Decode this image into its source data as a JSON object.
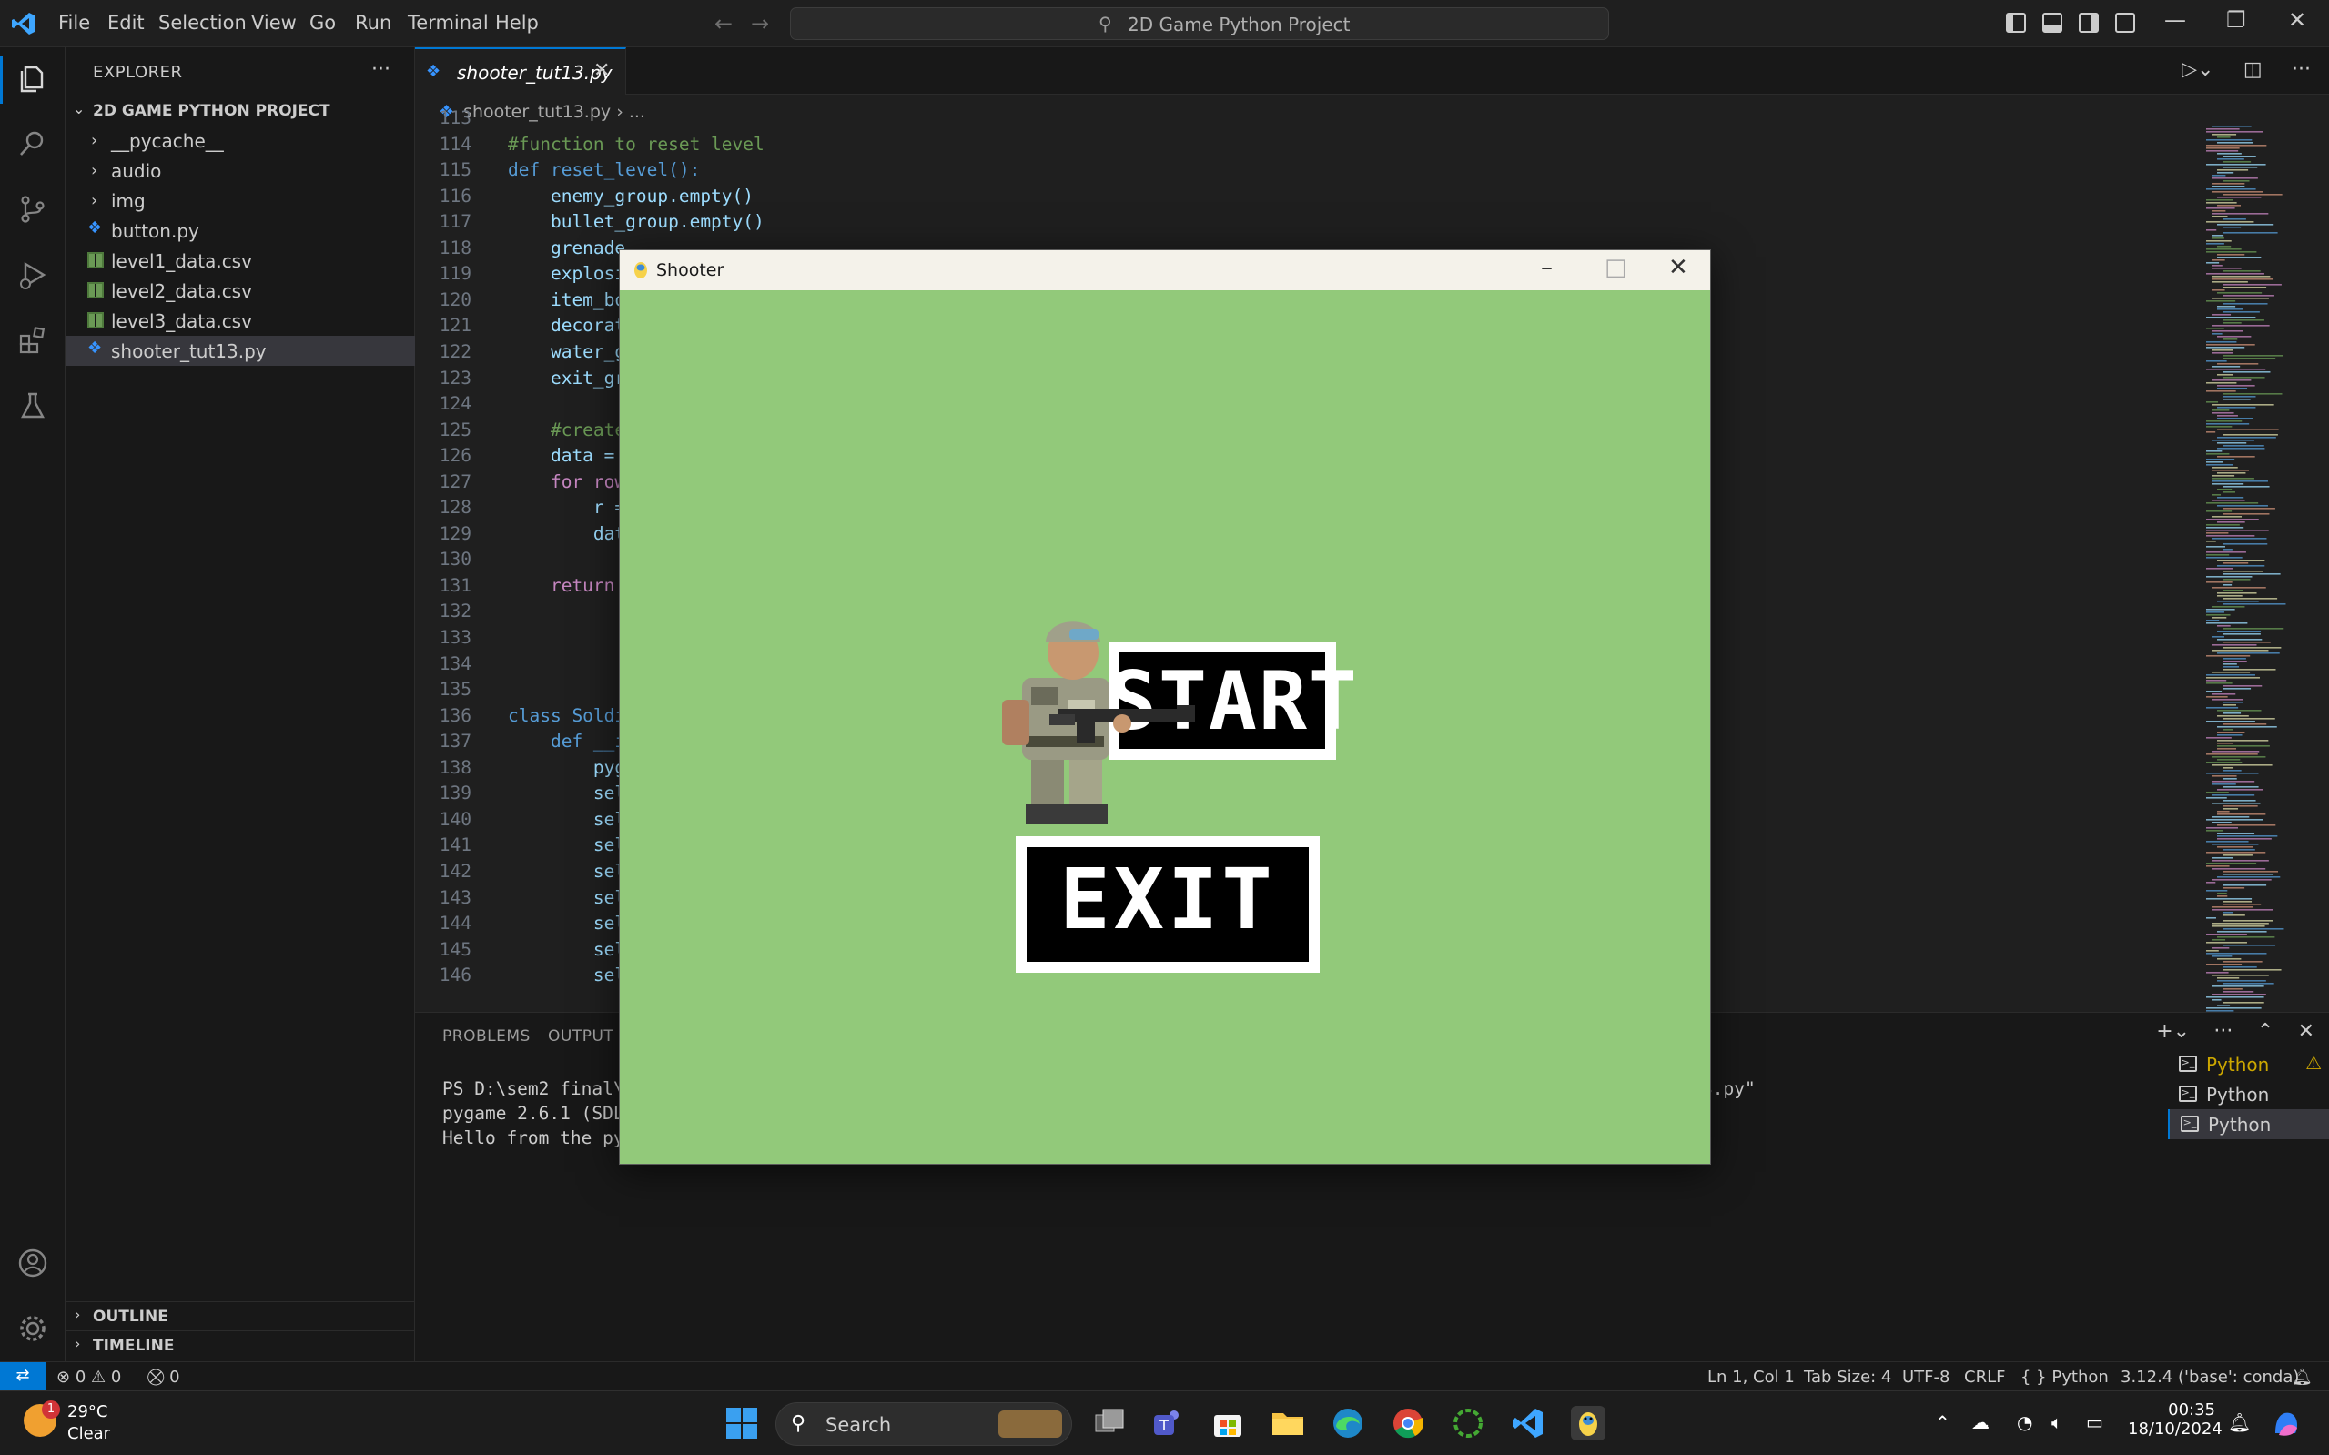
{
  "titlebar": {
    "menu": [
      "File",
      "Edit",
      "Selection",
      "View",
      "Go",
      "Run",
      "Terminal",
      "Help"
    ],
    "search_text": "2D Game Python Project"
  },
  "sidebar": {
    "title": "EXPLORER",
    "project": "2D GAME PYTHON PROJECT",
    "items": [
      {
        "label": "__pycache__",
        "type": "folder"
      },
      {
        "label": "audio",
        "type": "folder"
      },
      {
        "label": "img",
        "type": "folder"
      },
      {
        "label": "button.py",
        "type": "py"
      },
      {
        "label": "level1_data.csv",
        "type": "csv"
      },
      {
        "label": "level2_data.csv",
        "type": "csv"
      },
      {
        "label": "level3_data.csv",
        "type": "csv"
      },
      {
        "label": "shooter_tut13.py",
        "type": "py"
      }
    ],
    "outline": "OUTLINE",
    "timeline": "TIMELINE"
  },
  "editor": {
    "tab": "shooter_tut13.py",
    "breadcrumb": [
      "shooter_tut13.py",
      "..."
    ],
    "lines": [
      {
        "n": "113",
        "t": ""
      },
      {
        "n": "114",
        "t": "#function to reset level"
      },
      {
        "n": "115",
        "t": "def reset_level():"
      },
      {
        "n": "116",
        "t": "    enemy_group.empty()"
      },
      {
        "n": "117",
        "t": "    bullet_group.empty()"
      },
      {
        "n": "118",
        "t": "    grenade"
      },
      {
        "n": "119",
        "t": "    explosi"
      },
      {
        "n": "120",
        "t": "    item_bo"
      },
      {
        "n": "121",
        "t": "    decorat"
      },
      {
        "n": "122",
        "t": "    water_g"
      },
      {
        "n": "123",
        "t": "    exit_gr"
      },
      {
        "n": "124",
        "t": ""
      },
      {
        "n": "125",
        "t": "    #create"
      },
      {
        "n": "126",
        "t": "    data = "
      },
      {
        "n": "127",
        "t": "    for row"
      },
      {
        "n": "128",
        "t": "        r ="
      },
      {
        "n": "129",
        "t": "        dat"
      },
      {
        "n": "130",
        "t": ""
      },
      {
        "n": "131",
        "t": "    return "
      },
      {
        "n": "132",
        "t": ""
      },
      {
        "n": "133",
        "t": ""
      },
      {
        "n": "134",
        "t": ""
      },
      {
        "n": "135",
        "t": ""
      },
      {
        "n": "136",
        "t": "class Soldi"
      },
      {
        "n": "137",
        "t": "    def __i"
      },
      {
        "n": "138",
        "t": "        pyg"
      },
      {
        "n": "139",
        "t": "        sel"
      },
      {
        "n": "140",
        "t": "        sel"
      },
      {
        "n": "141",
        "t": "        sel"
      },
      {
        "n": "142",
        "t": "        sel"
      },
      {
        "n": "143",
        "t": "        sel"
      },
      {
        "n": "144",
        "t": "        sel"
      },
      {
        "n": "145",
        "t": "        sel"
      },
      {
        "n": "146",
        "t": "        sel"
      }
    ]
  },
  "panel": {
    "tabs": [
      "PROBLEMS",
      "OUTPUT"
    ],
    "terminal_lines": [
      "PS D:\\sem2 final\\2",
      "pygame 2.6.1 (SDL ",
      "Hello from the pyg"
    ],
    "terminal_tail": "3.py\"",
    "terminals": [
      "Python",
      "Python",
      "Python"
    ]
  },
  "statusbar": {
    "errors": "0",
    "warnings": "0",
    "ports": "0",
    "position": "Ln 1, Col 1",
    "tab_size": "Tab Size: 4",
    "encoding": "UTF-8",
    "eol": "CRLF",
    "language": "Python",
    "interpreter": "3.12.4 ('base': conda)"
  },
  "taskbar": {
    "weather_temp": "29°C",
    "weather_cond": "Clear",
    "weather_badge": "1",
    "search": "Search",
    "time": "00:35",
    "date": "18/10/2024"
  },
  "game": {
    "title": "Shooter",
    "start_label": "START",
    "exit_label": "EXIT",
    "bg_color": "#92c97a"
  },
  "colors": {
    "accent": "#0078d4",
    "editor_bg": "#1f1f1f",
    "sidebar_bg": "#181818"
  }
}
